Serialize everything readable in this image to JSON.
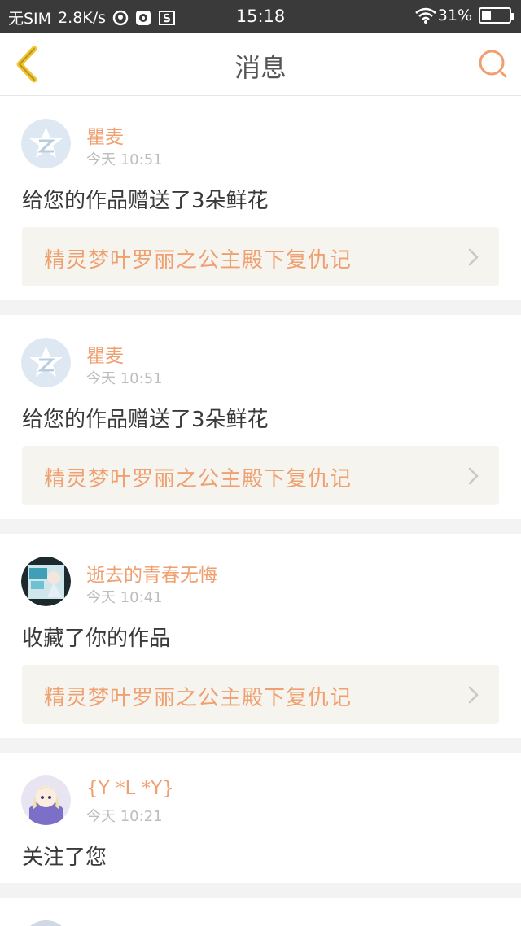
{
  "status_bar": {
    "carrier": "无SIM",
    "speed": "2.8K/s",
    "time": "15:18",
    "battery": "31%",
    "icons": [
      "qq-icon",
      "browser-icon",
      "s-icon",
      "wifi-icon",
      "battery-icon"
    ]
  },
  "nav": {
    "title": "消息",
    "back_icon": "back-chevron-icon",
    "search_icon": "search-icon",
    "accent": "#f0a070"
  },
  "messages": [
    {
      "user": "瞿麦",
      "time": "今天 10:51",
      "action": "给您的作品赠送了3朵鲜花",
      "work": "精灵梦叶罗丽之公主殿下复仇记",
      "avatar": "default-avatar-icon"
    },
    {
      "user": "瞿麦",
      "time": "今天 10:51",
      "action": "给您的作品赠送了3朵鲜花",
      "work": "精灵梦叶罗丽之公主殿下复仇记",
      "avatar": "default-avatar-icon"
    },
    {
      "user": "逝去的青春无悔",
      "time": "今天 10:41",
      "action": "收藏了你的作品",
      "work": "精灵梦叶罗丽之公主殿下复仇记",
      "avatar": "user-photo-avatar"
    },
    {
      "user": "{Y *L *Y}",
      "time": "今天 10:21",
      "action": "关注了您",
      "avatar": "anime-girl-avatar"
    }
  ]
}
